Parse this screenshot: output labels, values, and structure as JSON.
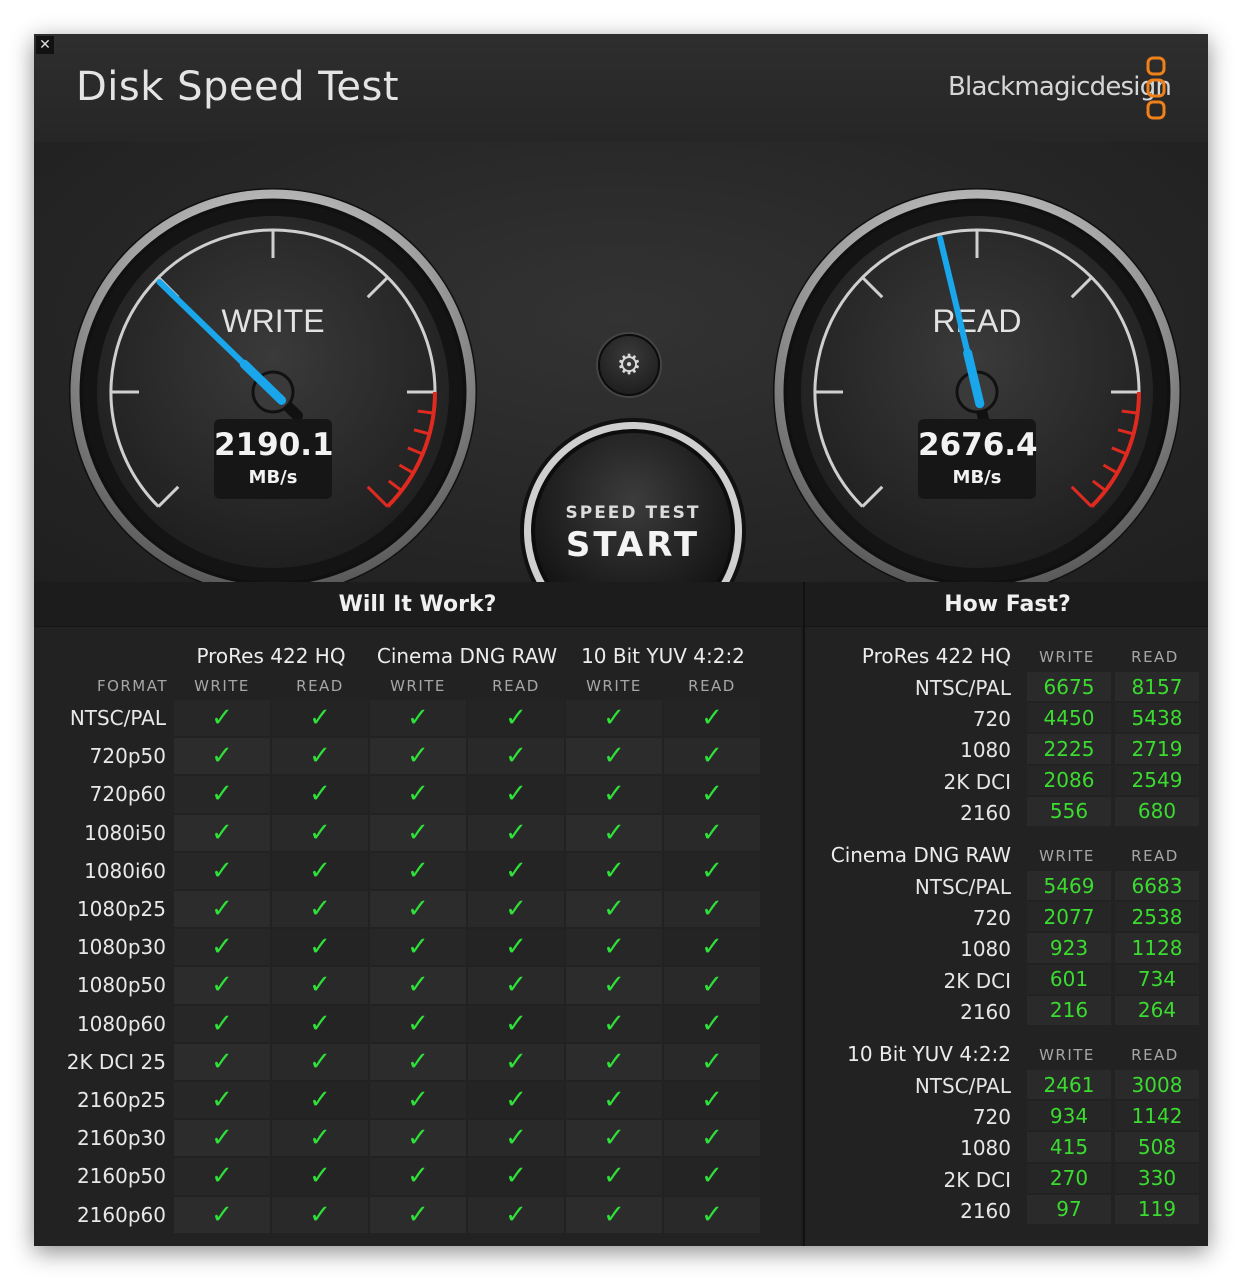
{
  "app": {
    "title": "Disk Speed Test",
    "brand": "Blackmagicdesign",
    "close_glyph": "✕",
    "settings_glyph": "⚙",
    "accent_color": "#f0801a"
  },
  "gauges": {
    "write": {
      "label": "WRITE",
      "value": "2190.1",
      "unit": "MB/s",
      "needle_fraction": 0.33,
      "needle_color": "#1aa6ea"
    },
    "read": {
      "label": "READ",
      "value": "2676.4",
      "unit": "MB/s",
      "needle_fraction": 0.45,
      "needle_color": "#1aa6ea"
    },
    "redzone_color": "#e02a20"
  },
  "start_button": {
    "line1": "SPEED TEST",
    "line2": "START"
  },
  "will_it_work": {
    "title": "Will It Work?",
    "format_header": "FORMAT",
    "codecs": [
      {
        "name": "ProRes 422 HQ",
        "write": "WRITE",
        "read": "READ"
      },
      {
        "name": "Cinema DNG RAW",
        "write": "WRITE",
        "read": "READ"
      },
      {
        "name": "10 Bit YUV 4:2:2",
        "write": "WRITE",
        "read": "READ"
      }
    ],
    "check_glyph": "✓",
    "rows": [
      {
        "format": "NTSC/PAL",
        "ok": [
          true,
          true,
          true,
          true,
          true,
          true
        ]
      },
      {
        "format": "720p50",
        "ok": [
          true,
          true,
          true,
          true,
          true,
          true
        ]
      },
      {
        "format": "720p60",
        "ok": [
          true,
          true,
          true,
          true,
          true,
          true
        ]
      },
      {
        "format": "1080i50",
        "ok": [
          true,
          true,
          true,
          true,
          true,
          true
        ]
      },
      {
        "format": "1080i60",
        "ok": [
          true,
          true,
          true,
          true,
          true,
          true
        ]
      },
      {
        "format": "1080p25",
        "ok": [
          true,
          true,
          true,
          true,
          true,
          true
        ]
      },
      {
        "format": "1080p30",
        "ok": [
          true,
          true,
          true,
          true,
          true,
          true
        ]
      },
      {
        "format": "1080p50",
        "ok": [
          true,
          true,
          true,
          true,
          true,
          true
        ]
      },
      {
        "format": "1080p60",
        "ok": [
          true,
          true,
          true,
          true,
          true,
          true
        ]
      },
      {
        "format": "2K DCI 25",
        "ok": [
          true,
          true,
          true,
          true,
          true,
          true
        ]
      },
      {
        "format": "2160p25",
        "ok": [
          true,
          true,
          true,
          true,
          true,
          true
        ]
      },
      {
        "format": "2160p30",
        "ok": [
          true,
          true,
          true,
          true,
          true,
          true
        ]
      },
      {
        "format": "2160p50",
        "ok": [
          true,
          true,
          true,
          true,
          true,
          true
        ]
      },
      {
        "format": "2160p60",
        "ok": [
          true,
          true,
          true,
          true,
          true,
          true
        ]
      }
    ]
  },
  "how_fast": {
    "title": "How Fast?",
    "sections": [
      {
        "codec": "ProRes 422 HQ",
        "write_label": "WRITE",
        "read_label": "READ",
        "rows": [
          {
            "format": "NTSC/PAL",
            "write": "6675",
            "read": "8157"
          },
          {
            "format": "720",
            "write": "4450",
            "read": "5438"
          },
          {
            "format": "1080",
            "write": "2225",
            "read": "2719"
          },
          {
            "format": "2K DCI",
            "write": "2086",
            "read": "2549"
          },
          {
            "format": "2160",
            "write": "556",
            "read": "680"
          }
        ]
      },
      {
        "codec": "Cinema DNG RAW",
        "write_label": "WRITE",
        "read_label": "READ",
        "rows": [
          {
            "format": "NTSC/PAL",
            "write": "5469",
            "read": "6683"
          },
          {
            "format": "720",
            "write": "2077",
            "read": "2538"
          },
          {
            "format": "1080",
            "write": "923",
            "read": "1128"
          },
          {
            "format": "2K DCI",
            "write": "601",
            "read": "734"
          },
          {
            "format": "2160",
            "write": "216",
            "read": "264"
          }
        ]
      },
      {
        "codec": "10 Bit YUV 4:2:2",
        "write_label": "WRITE",
        "read_label": "READ",
        "rows": [
          {
            "format": "NTSC/PAL",
            "write": "2461",
            "read": "3008"
          },
          {
            "format": "720",
            "write": "934",
            "read": "1142"
          },
          {
            "format": "1080",
            "write": "415",
            "read": "508"
          },
          {
            "format": "2K DCI",
            "write": "270",
            "read": "330"
          },
          {
            "format": "2160",
            "write": "97",
            "read": "119"
          }
        ]
      }
    ]
  }
}
